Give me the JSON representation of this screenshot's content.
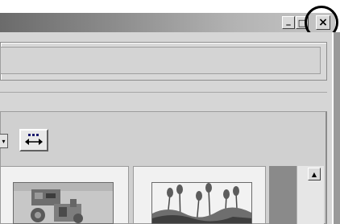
{
  "window": {
    "controls": {
      "minimize_glyph": "_",
      "maximize_glyph": "□",
      "close_glyph": "×"
    },
    "highlight": "close-button"
  },
  "toolbar": {
    "dropdown_glyph": "▾",
    "view_button_icon": "grid-arrows-icon"
  },
  "thumbnails": [
    {
      "icon": "machine-photo"
    },
    {
      "icon": "tulip-photo"
    }
  ],
  "scrollbar": {
    "up_glyph": "▲"
  },
  "colors": {
    "titlebar_start": "#6b6b6b",
    "titlebar_end": "#c6c6c6",
    "window_bg": "#d6d6d6",
    "scroll_track": "#8a8a8a"
  }
}
